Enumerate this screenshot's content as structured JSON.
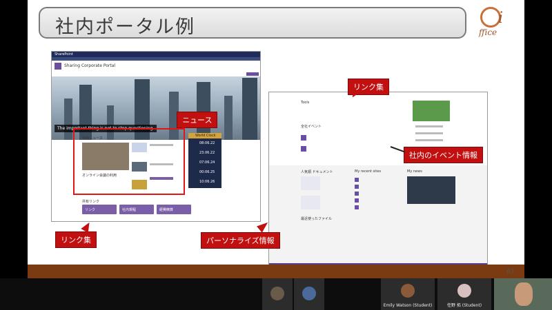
{
  "slide": {
    "title": "社内ポータル例",
    "logo_text": "ffice",
    "page_number": "67"
  },
  "left_screenshot": {
    "app_name": "SharePoint",
    "site_title": "Sharing Corporate Portal",
    "hero_caption": "The important thing is not to stop questioning.",
    "news_heading": "社内ニュース",
    "news_headline": "オンライン会議の利用",
    "world_clock_title": "World Clock",
    "times": [
      "08:06.22",
      "23.06.22",
      "07:06.24",
      "00:06.25",
      "10:06.26"
    ],
    "links_heading": "共有リンク",
    "link_buttons": [
      "リンク",
      "社内規程",
      "経費精算"
    ]
  },
  "right_screenshot": {
    "tools_label": "Tools",
    "events_heading": "全社イベント",
    "popular_docs_heading": "人気順 ドキュメント",
    "recent_sites_heading": "My recent sites",
    "my_news_heading": "My news",
    "recent_files_heading": "最近使ったファイル"
  },
  "callouts": {
    "news": "ニュース",
    "links_top": "リンク集",
    "events": "社内のイベント情報",
    "links_bottom": "リンク集",
    "personalize": "パーソナライズ情報"
  },
  "participants": [
    {
      "name": ""
    },
    {
      "name": ""
    },
    {
      "name": "Emily Watson (Student)"
    },
    {
      "name": "任野 拓 (Student)"
    }
  ]
}
